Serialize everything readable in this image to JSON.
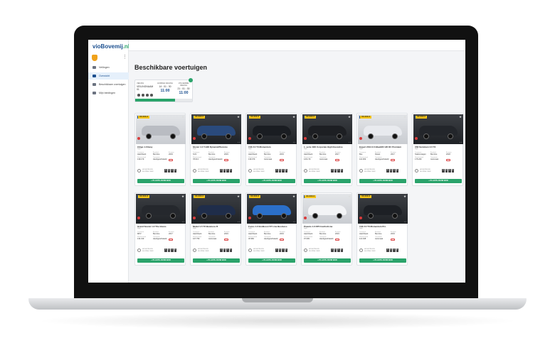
{
  "app": {
    "logo_main": "vioBovemij",
    "logo_tld": ".nl"
  },
  "sidebar": {
    "items": [
      {
        "label": "Veilingen",
        "active": false,
        "icon": "gavel-icon"
      },
      {
        "label": "Overzicht",
        "active": true,
        "icon": "car-icon"
      },
      {
        "label": "Beschikbare voertuigen",
        "active": false,
        "icon": "list-icon"
      },
      {
        "label": "Mijn biedingen",
        "active": false,
        "icon": "bid-icon"
      }
    ]
  },
  "page": {
    "title": "Beschikbare voertuigen"
  },
  "auction": {
    "left_label": "VEILING",
    "left_value": "VEILINGNAAM 01",
    "mid_label": "HUIDIGE VEILING",
    "mid_countdown": "14 : 01 : 30",
    "mid_time": "11:00",
    "right_label": "VOLGENDE VEILING",
    "right_countdown": "21 : 01 : 30",
    "right_time": "11:00",
    "progress_pct": 70
  },
  "button_label": "+ PLAATS JOUW BOD",
  "cars": [
    {
      "plate": "XX-XXX-X",
      "title": "Citigo 1.0 Easy",
      "sub": "Style",
      "specs": [
        "Hatchback",
        "Benzine",
        "2019",
        "139.179",
        "Handgeschakeld",
        ""
      ],
      "color": "#b9bcc2",
      "light": true
    },
    {
      "plate": "XX-XXX-X",
      "title": "Stonic 1.0 T-GDI DynamicPlusLine",
      "sub": "Style",
      "specs": [
        "SUV",
        "Benzine",
        "2019",
        "78.013",
        "Handgeschakeld",
        ""
      ],
      "color": "#2a4a7c",
      "light": false
    },
    {
      "plate": "XX-XXX-X",
      "title": "V40 2.0 T3 Momentum",
      "sub": "Style",
      "specs": [
        "Hatchback",
        "Benzine",
        "2019",
        "139.079",
        "Automaat",
        ""
      ],
      "color": "#1a1d22",
      "light": false
    },
    {
      "plate": "XX-XXX-X",
      "title": "1 -serie 118i Corporate High Executive",
      "sub": "Style",
      "specs": [
        "Hatchback",
        "Benzine",
        "2017",
        "126.179",
        "Automaat",
        ""
      ],
      "color": "#1d1f23",
      "light": false
    },
    {
      "plate": "XX-XXX-X",
      "title": "Expert 2014 2.0 BlueHDI 120 DC Premium",
      "sub": "Style",
      "specs": [
        "Bus",
        "Diesel",
        "2017",
        "110.369",
        "Handgeschakeld",
        ""
      ],
      "color": "#e8eaee",
      "light": true
    },
    {
      "plate": "XX-XXX-X",
      "title": "V60 Summum 2.0 T3",
      "sub": "Style",
      "specs": [
        "Stationwagen",
        "Benzine",
        "2018",
        "175.209",
        "Automaat",
        ""
      ],
      "color": "#23262b",
      "light": false
    },
    {
      "plate": "XX-XXX-X",
      "title": "Grand Scenic 1.3 TCe Intens",
      "sub": "Style",
      "specs": [
        "MPV",
        "Benzine",
        "2017",
        "134.319",
        "Handgeschakeld",
        ""
      ],
      "color": "#25282d",
      "light": false
    },
    {
      "plate": "XX-XXX-X",
      "title": "Model 1.5 T3 Business R",
      "sub": "Style",
      "specs": [
        "Hatchback",
        "Benzine",
        "2019",
        "107.759",
        "Automaat",
        ""
      ],
      "color": "#1f2d4a",
      "light": false
    },
    {
      "plate": "XX-XXX-X",
      "title": "Focus 1.0 EcoBoost ST Line Business",
      "sub": "Style",
      "specs": [
        "Hatchback",
        "Benzine",
        "2019",
        "30.982",
        "Handgeschakeld",
        ""
      ],
      "color": "#2b6fc9",
      "light": false
    },
    {
      "plate": "XX-XXX-X",
      "title": "Picanto 1.0 DPI ComfortLine",
      "sub": "Style",
      "specs": [
        "Hatchback",
        "Benzine",
        "2019",
        "97.099",
        "Handgeschakeld",
        ""
      ],
      "color": "#f3f4f6",
      "light": true
    },
    {
      "plate": "XX-XXX-X",
      "title": "V40 2.0 T3 Momentum Pro",
      "sub": "Style",
      "specs": [
        "Hatchback",
        "Benzine",
        "2019",
        "113.048",
        "Automaat",
        ""
      ],
      "color": "#1d2025",
      "light": false
    }
  ],
  "spec_labels": [
    "Carrosserie",
    "Brandstof",
    "Bouwjaar",
    "Kilometerstand",
    "Transmissie",
    ""
  ],
  "bid_label_1": "HOOGSTE BOD",
  "bid_label_2": "SLUITING OVER",
  "bid_digits": [
    "0",
    "2",
    "0",
    "0"
  ]
}
